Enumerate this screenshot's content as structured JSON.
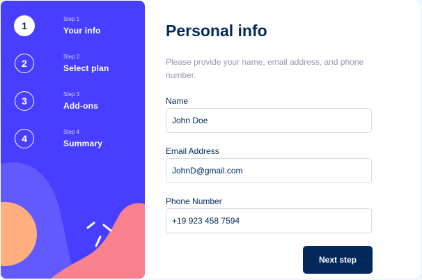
{
  "sidebar": {
    "steps": [
      {
        "number": "1",
        "step_label": "Step 1",
        "title": "Your info",
        "active": true
      },
      {
        "number": "2",
        "step_label": "Step 2",
        "title": "Select plan",
        "active": false
      },
      {
        "number": "3",
        "step_label": "Step 3",
        "title": "Add-ons",
        "active": false
      },
      {
        "number": "4",
        "step_label": "Step 4",
        "title": "Summary",
        "active": false
      }
    ]
  },
  "form": {
    "title": "Personal info",
    "subtitle": "Please provide your name, email address, and phone number.",
    "fields": {
      "name": {
        "label": "Name",
        "value": "John Doe"
      },
      "email": {
        "label": "Email Address",
        "value": "JohnD@gmail.com"
      },
      "phone": {
        "label": "Phone Number",
        "value": "+19 923 458 7594"
      }
    },
    "next_label": "Next step"
  },
  "colors": {
    "sidebar_bg": "#483eff",
    "navy": "#02295a",
    "muted_text": "#9699ab",
    "border": "#d6d9e6",
    "blob_purple": "#6259ff",
    "blob_orange": "#ffaf7e",
    "blob_pink": "#f9818e"
  }
}
